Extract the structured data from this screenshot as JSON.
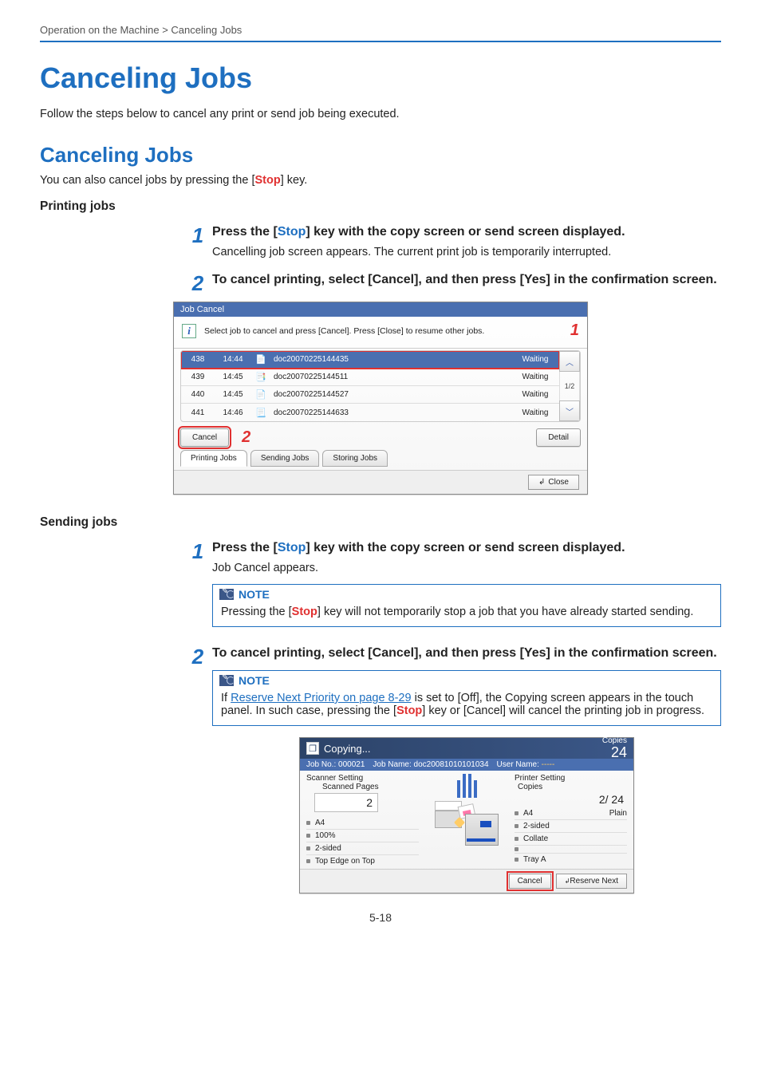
{
  "breadcrumb": "Operation on the Machine > Canceling Jobs",
  "h1": "Canceling Jobs",
  "intro": "Follow the steps below to cancel any print or send job being executed.",
  "h2": "Canceling Jobs",
  "subintro_before": "You can also cancel jobs by pressing the [",
  "subintro_stop": "Stop",
  "subintro_after": "] key.",
  "printing_heading": "Printing jobs",
  "sending_heading": "Sending jobs",
  "step1": {
    "num": "1",
    "title_a": "Press the [",
    "title_stop": "Stop",
    "title_b": "] key with the copy screen or send screen displayed.",
    "text": "Cancelling job screen appears. The current print job is temporarily interrupted."
  },
  "step2": {
    "num": "2",
    "title": "To cancel printing, select [Cancel], and then press [Yes] in the confirmation screen."
  },
  "sending_step1": {
    "num": "1",
    "title_a": "Press the [",
    "title_stop": "Stop",
    "title_b": "] key with the copy screen or send screen displayed.",
    "text": "Job Cancel appears."
  },
  "sending_step2": {
    "num": "2",
    "title": "To cancel printing, select [Cancel], and then press [Yes] in the confirmation screen."
  },
  "note1": {
    "label": "NOTE",
    "body_a": "Pressing the [",
    "body_stop": "Stop",
    "body_b": "] key will not temporarily stop a job that you have already started sending."
  },
  "note2": {
    "label": "NOTE",
    "body_a": "If ",
    "link": "Reserve Next Priority on page 8-29",
    "body_b": " is set to [Off], the Copying screen appears in the touch panel. In such case, pressing the [",
    "body_stop": "Stop",
    "body_c": "] key or [Cancel] will cancel the printing job in progress."
  },
  "page_number": "5-18",
  "panel": {
    "title": "Job Cancel",
    "info": "Select job to cancel and press [Cancel]. Press [Close] to resume other jobs.",
    "callout1": "1",
    "callout2": "2",
    "rows": [
      {
        "num": "438",
        "time": "14:44",
        "icon": "📄",
        "name": "doc20070225144435",
        "status": "Waiting"
      },
      {
        "num": "439",
        "time": "14:45",
        "icon": "📑",
        "name": "doc20070225144511",
        "status": "Waiting"
      },
      {
        "num": "440",
        "time": "14:45",
        "icon": "📄",
        "name": "doc20070225144527",
        "status": "Waiting"
      },
      {
        "num": "441",
        "time": "14:46",
        "icon": "📃",
        "name": "doc20070225144633",
        "status": "Waiting"
      }
    ],
    "page_indicator": "1/2",
    "cancel_btn": "Cancel",
    "detail_btn": "Detail",
    "tabs": [
      "Printing Jobs",
      "Sending Jobs",
      "Storing Jobs"
    ],
    "close_btn": "Close"
  },
  "copy": {
    "title": "Copying...",
    "copies_label": "Copies",
    "copies_value": "24",
    "subbar": {
      "jobno_label": "Job No.:",
      "jobno": "000021",
      "jobname_label": "Job Name:",
      "jobname": "doc20081010101034",
      "username_label": "User Name:",
      "username": "-----"
    },
    "scanner_setting": "Scanner Setting",
    "printer_setting": "Printer Setting",
    "scanned_pages_label": "Scanned Pages",
    "copies_small_label": "Copies",
    "scanned_pages": "2",
    "count_display": "2/   24",
    "left_list": [
      "A4",
      "100%",
      "2-sided",
      "Top Edge on Top"
    ],
    "right_list": [
      "A4",
      "2-sided",
      "Collate",
      "",
      "Tray A"
    ],
    "right_plain": "Plain",
    "cancel_btn": "Cancel",
    "reserve_btn": "Reserve Next"
  }
}
